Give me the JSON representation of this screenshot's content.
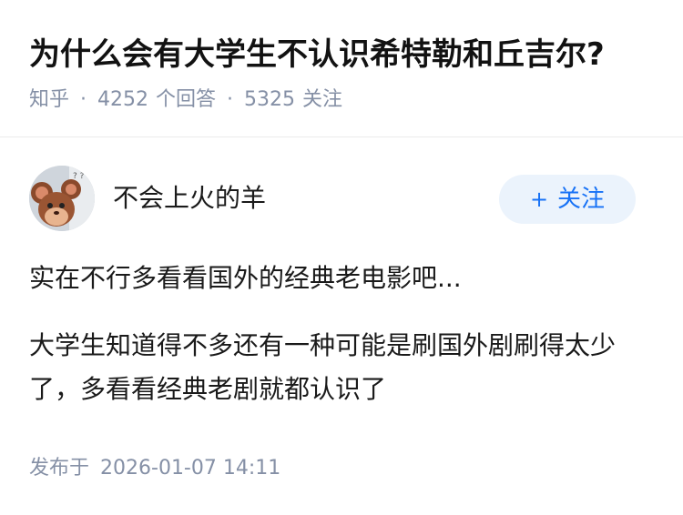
{
  "question": {
    "title": "为什么会有大学生不认识希特勒和丘吉尔?",
    "source": "知乎",
    "answer_count": "4252",
    "answer_label": "个回答",
    "follower_count": "5325",
    "follower_label": "关注",
    "separator": "·"
  },
  "author": {
    "name": "不会上火的羊",
    "avatar_icon": "cartoon-mouse-avatar",
    "follow_plus": "+",
    "follow_label": "关注"
  },
  "answer": {
    "paragraphs": [
      "实在不行多看看国外的经典老电影吧...",
      "大学生知道得不多还有一种可能是刷国外剧刷得太少了，多看看经典老剧就都认识了"
    ],
    "published_label": "发布于",
    "published_time": "2026-01-07 14:11"
  },
  "colors": {
    "accent": "#1772f6",
    "follow_bg": "#ebf3fc",
    "meta_text": "#8590a6",
    "title_text": "#121212"
  }
}
